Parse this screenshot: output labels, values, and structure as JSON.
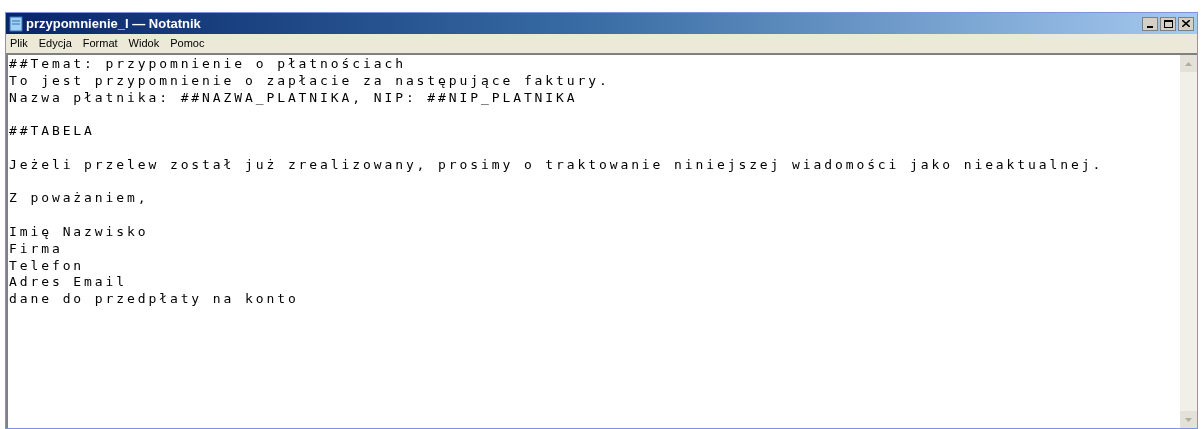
{
  "window": {
    "title": "przypomnienie_I — Notatnik"
  },
  "menu": [
    "Plik",
    "Edycja",
    "Format",
    "Widok",
    "Pomoc"
  ],
  "editor": {
    "paragraphs": [
      [
        "##Temat: przypomnienie o płatnościach",
        "To jest przypomnienie o zapłacie za następujące faktury.",
        "Nazwa płatnika: ##NAZWA_PLATNIKA, NIP: ##NIP_PLATNIKA"
      ],
      [
        "##TABELA"
      ],
      [
        "Jeżeli przelew został już zrealizowany, prosimy o traktowanie niniejszej wiadomości jako nieaktualnej."
      ],
      [
        "Z poważaniem,"
      ],
      [
        "Imię Nazwisko",
        "Firma",
        "Telefon",
        "Adres Email",
        "dane do przedpłaty na konto"
      ]
    ]
  }
}
